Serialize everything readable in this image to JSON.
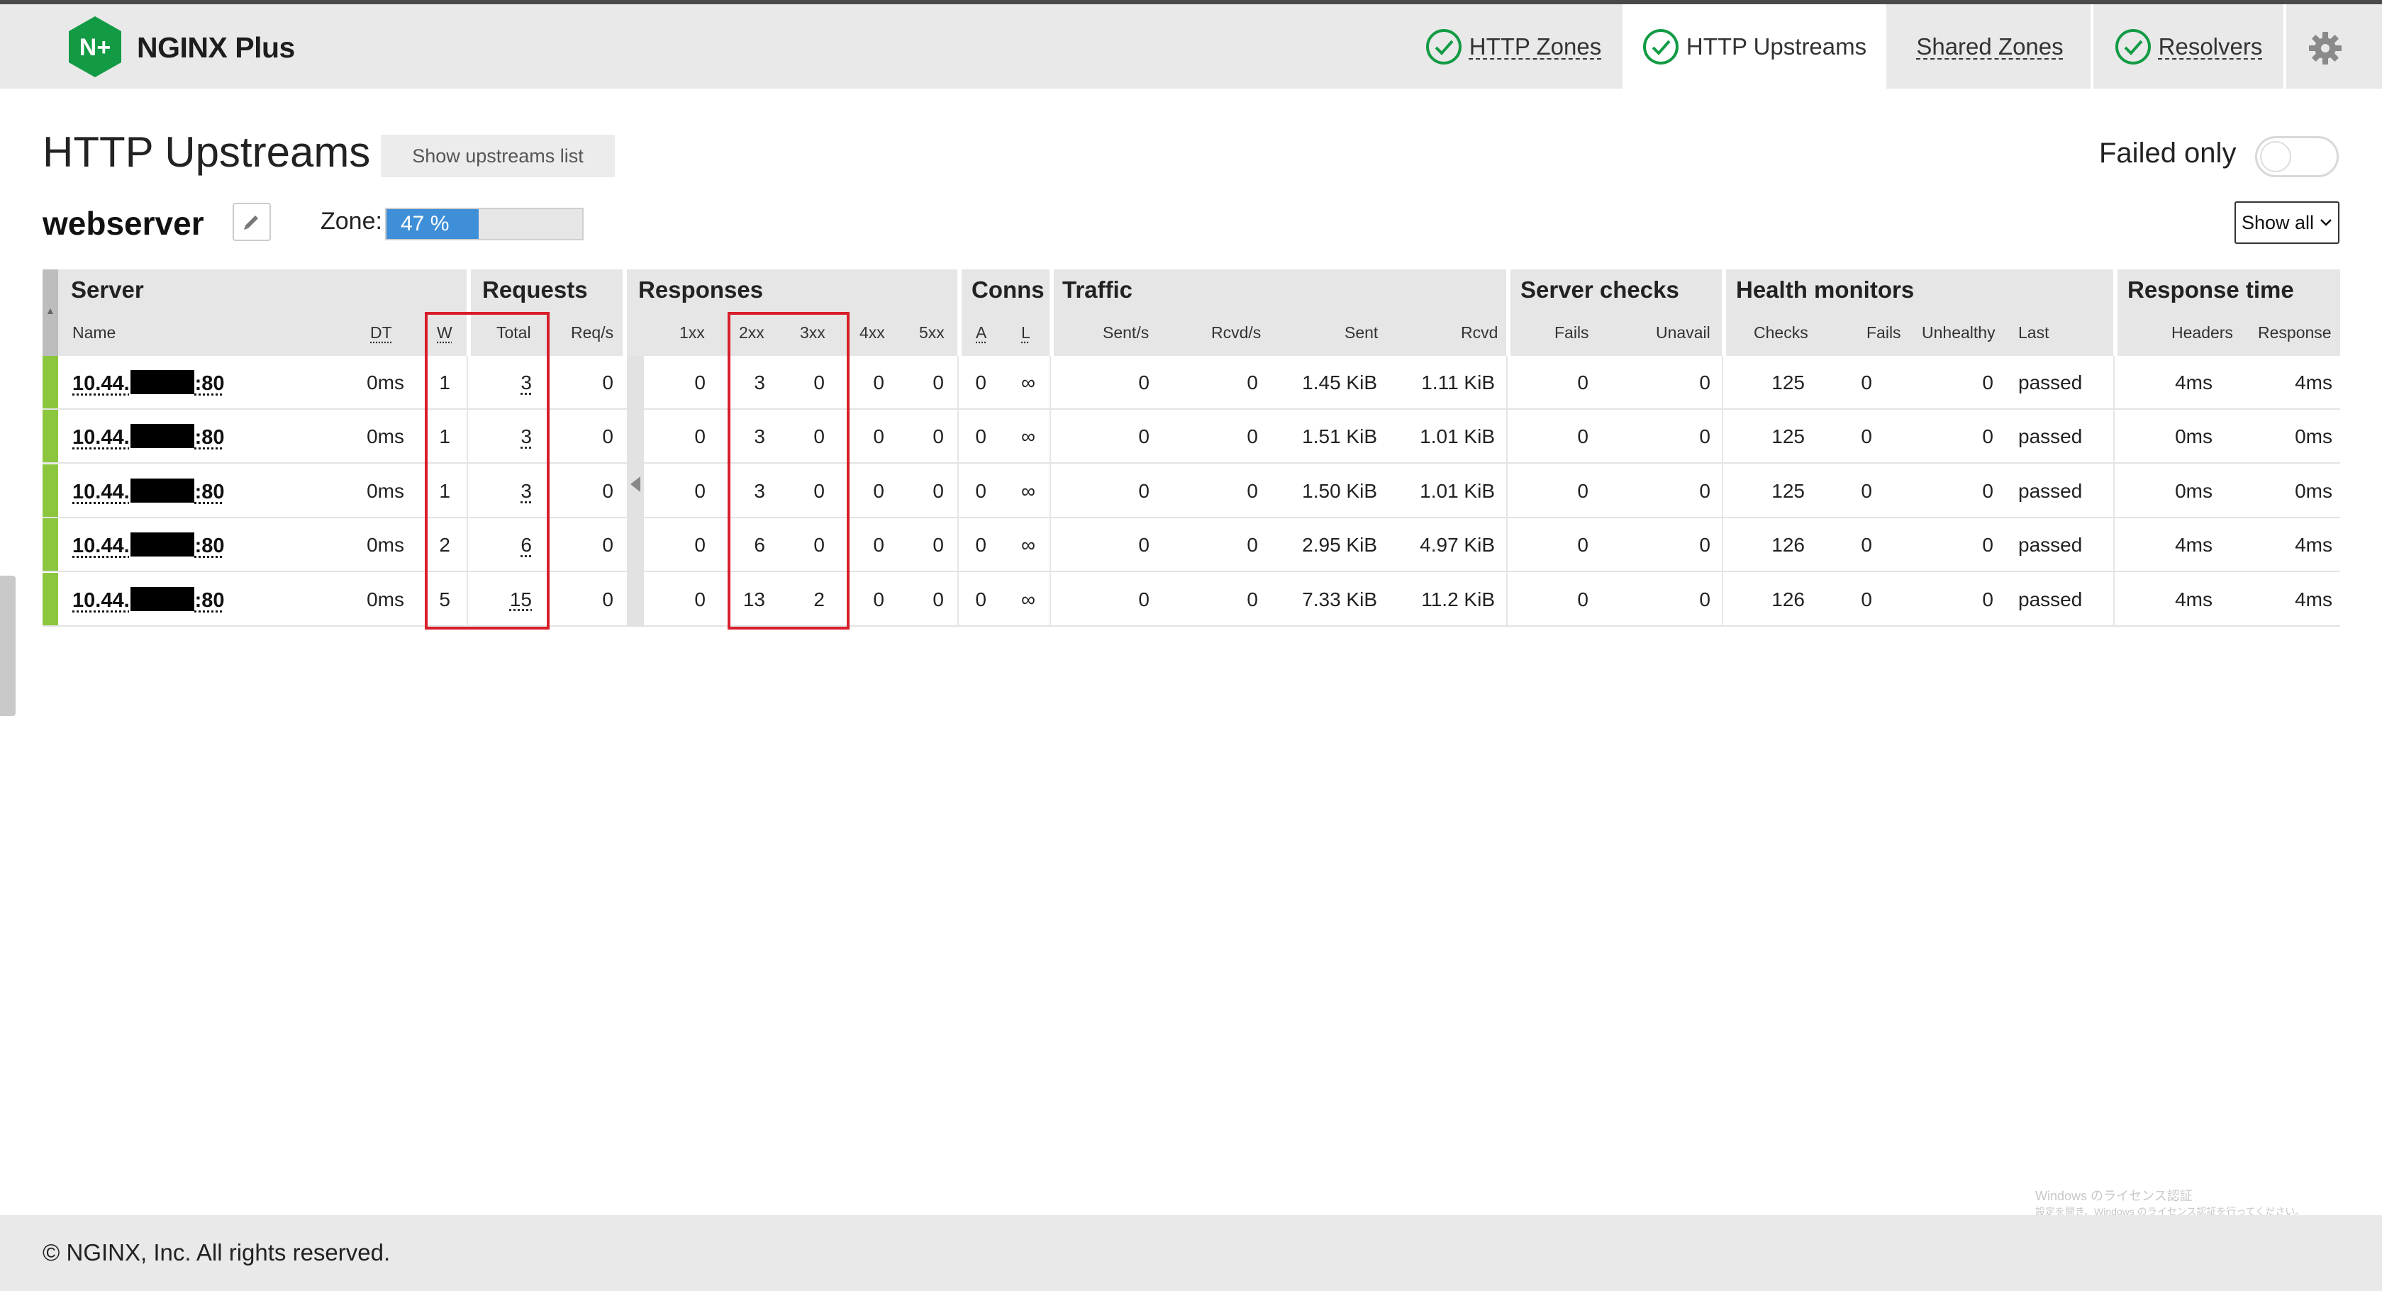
{
  "brand": {
    "name": "NGINX Plus",
    "logo_text": "N+"
  },
  "nav": {
    "tabs": [
      {
        "label": "HTTP Zones",
        "status": "ok"
      },
      {
        "label": "HTTP Upstreams",
        "status": "ok",
        "active": true
      },
      {
        "label": "Shared Zones"
      },
      {
        "label": "Resolvers",
        "status": "ok"
      }
    ],
    "settings_icon": "gear-icon"
  },
  "page": {
    "title": "HTTP Upstreams",
    "show_list_button": "Show upstreams list",
    "failed_only_label": "Failed only",
    "failed_only_enabled": false
  },
  "upstream": {
    "name": "webserver",
    "zone_label": "Zone:",
    "zone_usage_text": "47 %",
    "zone_usage_fraction": 0.47,
    "filter_select": "Show all"
  },
  "table": {
    "groups": {
      "server": "Server",
      "requests": "Requests",
      "responses": "Responses",
      "conns": "Conns",
      "traffic": "Traffic",
      "server_checks": "Server checks",
      "health_monitors": "Health monitors",
      "response_time": "Response time"
    },
    "columns": {
      "name": "Name",
      "dt": "DT",
      "w": "W",
      "total": "Total",
      "reqs": "Req/s",
      "r1xx": "1xx",
      "r2xx": "2xx",
      "r3xx": "3xx",
      "r4xx": "4xx",
      "r5xx": "5xx",
      "a": "A",
      "l": "L",
      "sent_s": "Sent/s",
      "rcvd_s": "Rcvd/s",
      "sent": "Sent",
      "rcvd": "Rcvd",
      "fails": "Fails",
      "unavail": "Unavail",
      "checks": "Checks",
      "hm_fails": "Fails",
      "unhealthy": "Unhealthy",
      "last": "Last",
      "headers": "Headers",
      "response": "Response"
    },
    "rows": [
      {
        "name_prefix": "10.44.",
        "name_suffix": ":80",
        "dt": "0ms",
        "w": "1",
        "total": "3",
        "reqs": "0",
        "r1xx": "0",
        "r2xx": "3",
        "r3xx": "0",
        "r4xx": "0",
        "r5xx": "0",
        "a": "0",
        "l": "∞",
        "sent_s": "0",
        "rcvd_s": "0",
        "sent": "1.45 KiB",
        "rcvd": "1.11 KiB",
        "fails": "0",
        "unavail": "0",
        "checks": "125",
        "hm_fails": "0",
        "unhealthy": "0",
        "last": "passed",
        "headers": "4ms",
        "response": "4ms"
      },
      {
        "name_prefix": "10.44.",
        "name_suffix": ":80",
        "dt": "0ms",
        "w": "1",
        "total": "3",
        "reqs": "0",
        "r1xx": "0",
        "r2xx": "3",
        "r3xx": "0",
        "r4xx": "0",
        "r5xx": "0",
        "a": "0",
        "l": "∞",
        "sent_s": "0",
        "rcvd_s": "0",
        "sent": "1.51 KiB",
        "rcvd": "1.01 KiB",
        "fails": "0",
        "unavail": "0",
        "checks": "125",
        "hm_fails": "0",
        "unhealthy": "0",
        "last": "passed",
        "headers": "0ms",
        "response": "0ms"
      },
      {
        "name_prefix": "10.44.",
        "name_suffix": ":80",
        "dt": "0ms",
        "w": "1",
        "total": "3",
        "reqs": "0",
        "r1xx": "0",
        "r2xx": "3",
        "r3xx": "0",
        "r4xx": "0",
        "r5xx": "0",
        "a": "0",
        "l": "∞",
        "sent_s": "0",
        "rcvd_s": "0",
        "sent": "1.50 KiB",
        "rcvd": "1.01 KiB",
        "fails": "0",
        "unavail": "0",
        "checks": "125",
        "hm_fails": "0",
        "unhealthy": "0",
        "last": "passed",
        "headers": "0ms",
        "response": "0ms"
      },
      {
        "name_prefix": "10.44.",
        "name_suffix": ":80",
        "dt": "0ms",
        "w": "2",
        "total": "6",
        "reqs": "0",
        "r1xx": "0",
        "r2xx": "6",
        "r3xx": "0",
        "r4xx": "0",
        "r5xx": "0",
        "a": "0",
        "l": "∞",
        "sent_s": "0",
        "rcvd_s": "0",
        "sent": "2.95 KiB",
        "rcvd": "4.97 KiB",
        "fails": "0",
        "unavail": "0",
        "checks": "126",
        "hm_fails": "0",
        "unhealthy": "0",
        "last": "passed",
        "headers": "4ms",
        "response": "4ms"
      },
      {
        "name_prefix": "10.44.",
        "name_suffix": ":80",
        "dt": "0ms",
        "w": "5",
        "total": "15",
        "reqs": "0",
        "r1xx": "0",
        "r2xx": "13",
        "r3xx": "2",
        "r4xx": "0",
        "r5xx": "0",
        "a": "0",
        "l": "∞",
        "sent_s": "0",
        "rcvd_s": "0",
        "sent": "7.33 KiB",
        "rcvd": "11.2 KiB",
        "fails": "0",
        "unavail": "0",
        "checks": "126",
        "hm_fails": "0",
        "unhealthy": "0",
        "last": "passed",
        "headers": "4ms",
        "response": "4ms"
      }
    ]
  },
  "watermark": {
    "line1": "Windows のライセンス認証",
    "line2": "設定を開き、Windows のライセンス認証を行ってください。"
  },
  "footer": {
    "copyright": "© NGINX, Inc. All rights reserved."
  },
  "colors": {
    "brand_green": "#129b44",
    "status_green": "#8cc63f",
    "zone_bar": "#3f8fd8",
    "highlight_red": "#d81e2a"
  }
}
